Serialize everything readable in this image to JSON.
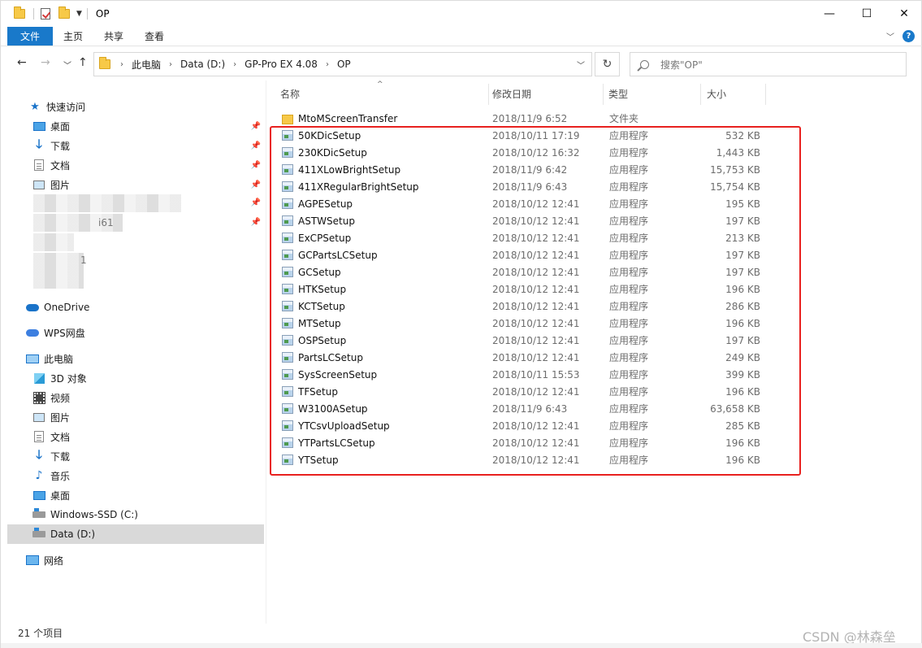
{
  "titlebar": {
    "title": "OP",
    "minimize": "—",
    "maximize": "☐",
    "close": "✕"
  },
  "ribbon": {
    "tabs": [
      "文件",
      "主页",
      "共享",
      "查看"
    ],
    "collapse": "﹀",
    "help": "?"
  },
  "nav": {
    "back": "←",
    "forward": "→",
    "recent": "﹀",
    "up": "↑",
    "refresh": "↻"
  },
  "address": {
    "crumbs": [
      "此电脑",
      "Data (D:)",
      "GP-Pro EX 4.08",
      "OP"
    ],
    "dropdown": "﹀"
  },
  "search": {
    "placeholder": "搜索\"OP\""
  },
  "sidebar": {
    "quick_access": "快速访问",
    "quick_items": [
      "桌面",
      "下载",
      "文档",
      "图片"
    ],
    "blurred_fragment": "i61",
    "blurred_fragment2": "1",
    "onedrive": "OneDrive",
    "wps": "WPS网盘",
    "thispc": "此电脑",
    "pc_items": [
      "3D 对象",
      "视频",
      "图片",
      "文档",
      "下载",
      "音乐",
      "桌面",
      "Windows-SSD (C:)",
      "Data (D:)"
    ],
    "network": "网络"
  },
  "columns": {
    "name": "名称",
    "date": "修改日期",
    "type": "类型",
    "size": "大小"
  },
  "files": [
    {
      "name": "MtoMScreenTransfer",
      "date": "2018/11/9 6:52",
      "type": "文件夹",
      "size": "",
      "kind": "folder"
    },
    {
      "name": "50KDicSetup",
      "date": "2018/10/11 17:19",
      "type": "应用程序",
      "size": "532 KB",
      "kind": "exe"
    },
    {
      "name": "230KDicSetup",
      "date": "2018/10/12 16:32",
      "type": "应用程序",
      "size": "1,443 KB",
      "kind": "exe"
    },
    {
      "name": "411XLowBrightSetup",
      "date": "2018/11/9 6:42",
      "type": "应用程序",
      "size": "15,753 KB",
      "kind": "exe"
    },
    {
      "name": "411XRegularBrightSetup",
      "date": "2018/11/9 6:43",
      "type": "应用程序",
      "size": "15,754 KB",
      "kind": "exe"
    },
    {
      "name": "AGPESetup",
      "date": "2018/10/12 12:41",
      "type": "应用程序",
      "size": "195 KB",
      "kind": "exe"
    },
    {
      "name": "ASTWSetup",
      "date": "2018/10/12 12:41",
      "type": "应用程序",
      "size": "197 KB",
      "kind": "exe"
    },
    {
      "name": "ExCPSetup",
      "date": "2018/10/12 12:41",
      "type": "应用程序",
      "size": "213 KB",
      "kind": "exe"
    },
    {
      "name": "GCPartsLCSetup",
      "date": "2018/10/12 12:41",
      "type": "应用程序",
      "size": "197 KB",
      "kind": "exe"
    },
    {
      "name": "GCSetup",
      "date": "2018/10/12 12:41",
      "type": "应用程序",
      "size": "197 KB",
      "kind": "exe"
    },
    {
      "name": "HTKSetup",
      "date": "2018/10/12 12:41",
      "type": "应用程序",
      "size": "196 KB",
      "kind": "exe"
    },
    {
      "name": "KCTSetup",
      "date": "2018/10/12 12:41",
      "type": "应用程序",
      "size": "286 KB",
      "kind": "exe"
    },
    {
      "name": "MTSetup",
      "date": "2018/10/12 12:41",
      "type": "应用程序",
      "size": "196 KB",
      "kind": "exe"
    },
    {
      "name": "OSPSetup",
      "date": "2018/10/12 12:41",
      "type": "应用程序",
      "size": "197 KB",
      "kind": "exe"
    },
    {
      "name": "PartsLCSetup",
      "date": "2018/10/12 12:41",
      "type": "应用程序",
      "size": "249 KB",
      "kind": "exe"
    },
    {
      "name": "SysScreenSetup",
      "date": "2018/10/11 15:53",
      "type": "应用程序",
      "size": "399 KB",
      "kind": "exe"
    },
    {
      "name": "TFSetup",
      "date": "2018/10/12 12:41",
      "type": "应用程序",
      "size": "196 KB",
      "kind": "exe"
    },
    {
      "name": "W3100ASetup",
      "date": "2018/11/9 6:43",
      "type": "应用程序",
      "size": "63,658 KB",
      "kind": "exe"
    },
    {
      "name": "YTCsvUploadSetup",
      "date": "2018/10/12 12:41",
      "type": "应用程序",
      "size": "285 KB",
      "kind": "exe"
    },
    {
      "name": "YTPartsLCSetup",
      "date": "2018/10/12 12:41",
      "type": "应用程序",
      "size": "196 KB",
      "kind": "exe"
    },
    {
      "name": "YTSetup",
      "date": "2018/10/12 12:41",
      "type": "应用程序",
      "size": "196 KB",
      "kind": "exe"
    }
  ],
  "status": {
    "count": "21 个项目"
  },
  "watermark": "CSDN @林森垒",
  "colors": {
    "accent": "#1979ca",
    "highlight_box": "#e8211f",
    "selected_bg": "#d9d9d9"
  }
}
